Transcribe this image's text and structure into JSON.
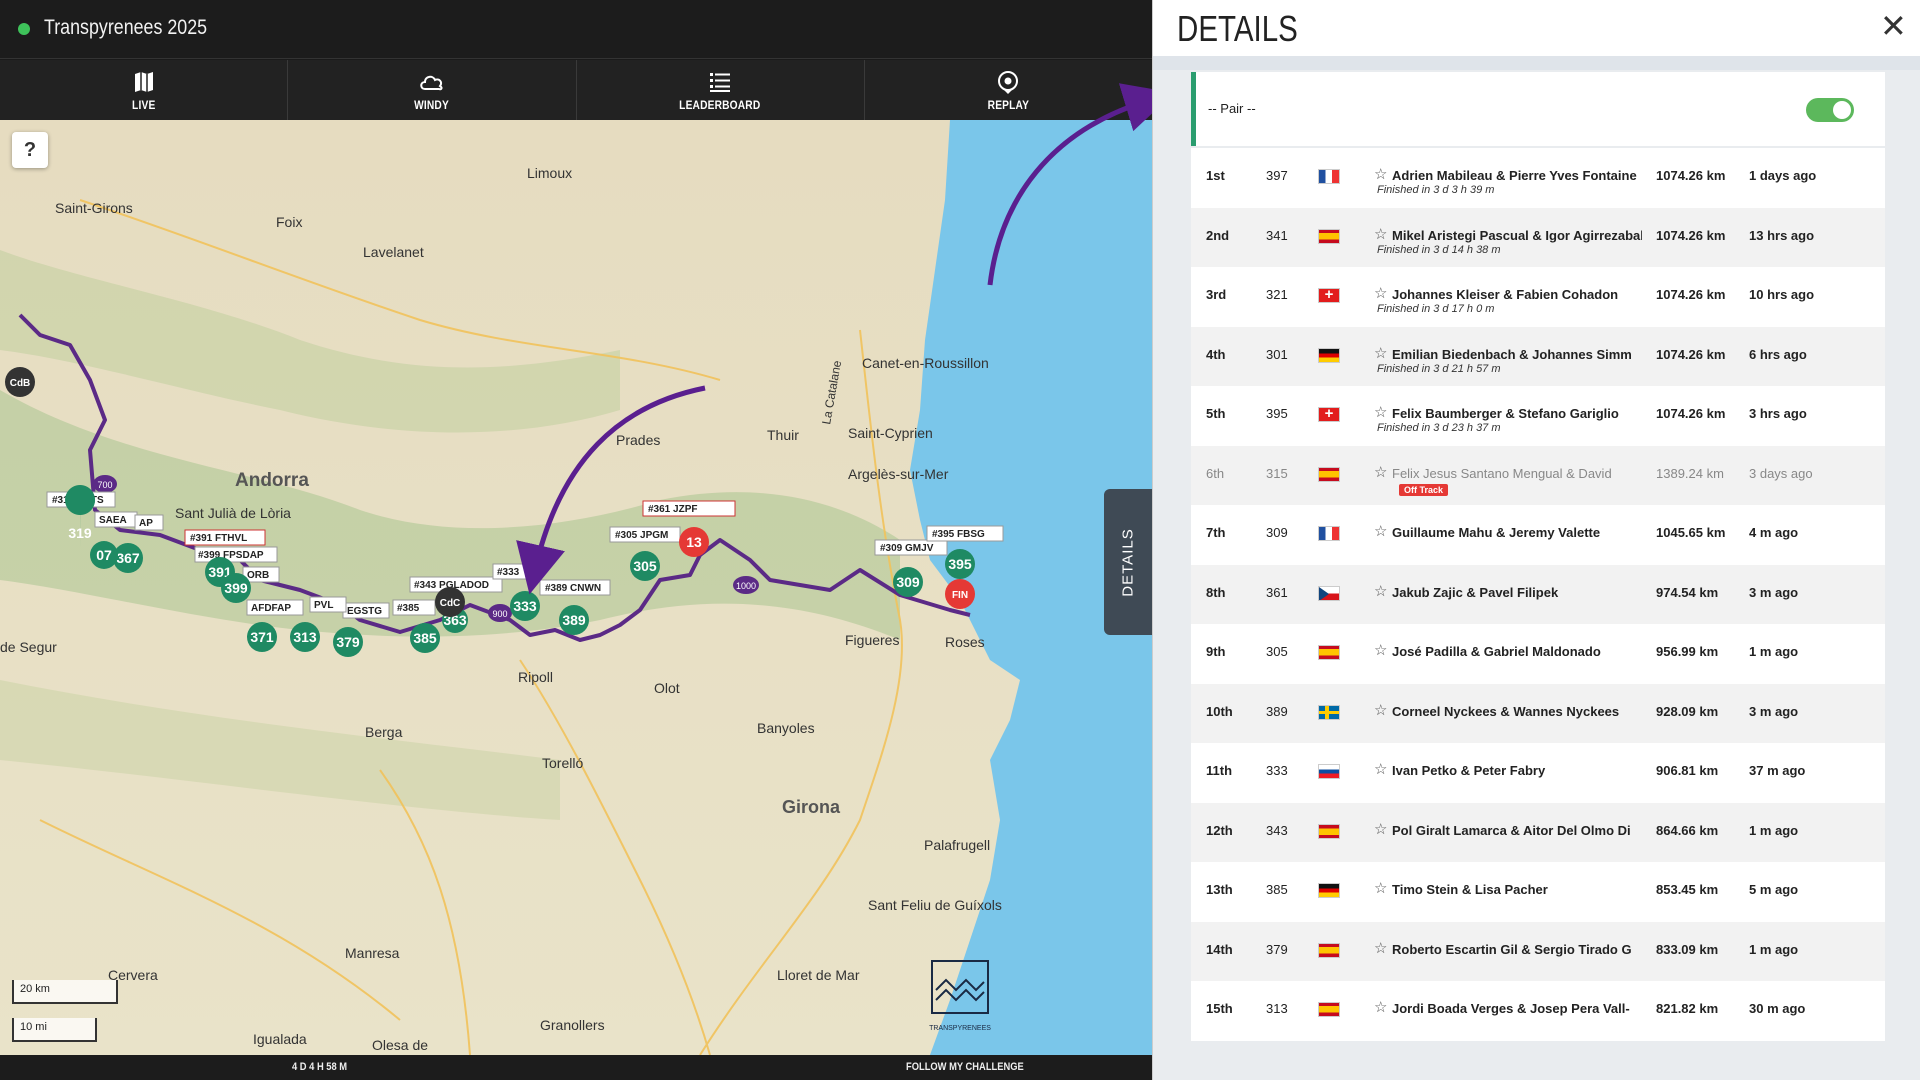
{
  "app": {
    "title": "Transpyrenees 2025"
  },
  "nav": [
    {
      "label": "LIVE",
      "icon": "map-icon"
    },
    {
      "label": "WINDY",
      "icon": "cloud-icon"
    },
    {
      "label": "LEADERBOARD",
      "icon": "list-icon"
    },
    {
      "label": "REPLAY",
      "icon": "replay-icon"
    }
  ],
  "map": {
    "help_label": "?",
    "scale_km": "20 km",
    "scale_mi": "10 mi",
    "details_tab_label": "DETAILS",
    "places": [
      "Saint-Girons",
      "Foix",
      "Limoux",
      "Lavelanet",
      "Andorra",
      "Sant Julià de Lòria",
      "Canet-en-Roussillon",
      "Prades",
      "Thuir",
      "La Catalane",
      "Saint-Cyprien",
      "Argelès-sur-Mer",
      "Figueres",
      "Roses",
      "Ripoll",
      "Olot",
      "Banyoles",
      "Berga",
      "Torelló",
      "Girona",
      "Palafrugell",
      "Sant Feliu de Guíxols",
      "Manresa",
      "Lloret de Mar",
      "Granollers",
      "Igualada",
      "Olesa de",
      "Cervera",
      "de Segur",
      "TRANSPYRENEES"
    ],
    "checkpoints": [
      "CdB",
      "CdC",
      "FIN"
    ],
    "tags": [
      "#319 KETS",
      "#391 FTHVL",
      "#399 FPSDAP",
      "#361 JZPF",
      "#305 JPGM",
      "#309 GMJV",
      "#395 FBSG",
      "#343 PGLADOD",
      "#389 CNWN",
      "#333",
      "#385",
      "AFDFAP",
      "EGSTG",
      "PVL",
      "ORB",
      "SAEA",
      "AP"
    ],
    "markers": [
      "319",
      "391",
      "399",
      "367",
      "07",
      "371",
      "313",
      "379",
      "385",
      "333",
      "389",
      "305",
      "309",
      "395",
      "363",
      "13"
    ],
    "route_labels": [
      "700",
      "900",
      "1000"
    ]
  },
  "bottom": {
    "elapsed": "4 D 4 H 58 M",
    "follow": "FOLLOW MY CHALLENGE"
  },
  "details": {
    "title": "DETAILS",
    "close": "✕",
    "pair_label": "-- Pair --",
    "pair_toggle_on": true,
    "rows": [
      {
        "pos": "1st",
        "num": "397",
        "flag": "FR",
        "name": "Adrien Mabileau & Pierre Yves Fontaine",
        "sub": "Finished in 3 d 3 h 39 m",
        "km": "1074.26 km",
        "ago": "1 days ago"
      },
      {
        "pos": "2nd",
        "num": "341",
        "flag": "ES",
        "name": "Mikel Aristegi Pascual & Igor Agirrezabal",
        "sub": "Finished in 3 d 14 h 38 m",
        "km": "1074.26 km",
        "ago": "13 hrs ago"
      },
      {
        "pos": "3rd",
        "num": "321",
        "flag": "CH",
        "name": "Johannes Kleiser & Fabien Cohadon",
        "sub": "Finished in 3 d 17 h 0 m",
        "km": "1074.26 km",
        "ago": "10 hrs ago"
      },
      {
        "pos": "4th",
        "num": "301",
        "flag": "DE",
        "name": "Emilian Biedenbach & Johannes Simm",
        "sub": "Finished in 3 d 21 h 57 m",
        "km": "1074.26 km",
        "ago": "6 hrs ago"
      },
      {
        "pos": "5th",
        "num": "395",
        "flag": "CH",
        "name": "Felix Baumberger & Stefano Gariglio",
        "sub": "Finished in 3 d 23 h 37 m",
        "km": "1074.26 km",
        "ago": "3 hrs ago"
      },
      {
        "pos": "6th",
        "num": "315",
        "flag": "ES",
        "name": "Felix Jesus Santano Mengual & David",
        "badge": "Off Track",
        "km": "1389.24 km",
        "ago": "3 days ago",
        "dim": true
      },
      {
        "pos": "7th",
        "num": "309",
        "flag": "FR",
        "name": "Guillaume Mahu & Jeremy Valette",
        "km": "1045.65 km",
        "ago": "4 m ago"
      },
      {
        "pos": "8th",
        "num": "361",
        "flag": "CZ",
        "name": "Jakub Zajic & Pavel Filipek",
        "km": "974.54 km",
        "ago": "3 m ago"
      },
      {
        "pos": "9th",
        "num": "305",
        "flag": "ES",
        "name": "José Padilla & Gabriel Maldonado",
        "km": "956.99 km",
        "ago": "1 m ago"
      },
      {
        "pos": "10th",
        "num": "389",
        "flag": "SE",
        "name": "Corneel Nyckees & Wannes Nyckees",
        "km": "928.09 km",
        "ago": "3 m ago"
      },
      {
        "pos": "11th",
        "num": "333",
        "flag": "SK",
        "name": "Ivan Petko & Peter Fabry",
        "km": "906.81 km",
        "ago": "37 m ago"
      },
      {
        "pos": "12th",
        "num": "343",
        "flag": "ES",
        "name": "Pol Giralt Lamarca & Aitor Del Olmo Di",
        "km": "864.66 km",
        "ago": "1 m ago"
      },
      {
        "pos": "13th",
        "num": "385",
        "flag": "DE",
        "name": "Timo Stein & Lisa Pacher",
        "km": "853.45 km",
        "ago": "5 m ago"
      },
      {
        "pos": "14th",
        "num": "379",
        "flag": "ES",
        "name": "Roberto Escartin Gil & Sergio Tirado G",
        "km": "833.09 km",
        "ago": "1 m ago"
      },
      {
        "pos": "15th",
        "num": "313",
        "flag": "ES",
        "name": "Jordi Boada Verges & Josep Pera Vall-",
        "km": "821.82 km",
        "ago": "30 m ago"
      }
    ]
  },
  "colors": {
    "accent": "#2a9d6f",
    "route": "#5b2a86",
    "arrow": "#5a1f8f",
    "marker": "#1f8a63",
    "finish": "#e53935",
    "sea": "#6fc3e8"
  }
}
